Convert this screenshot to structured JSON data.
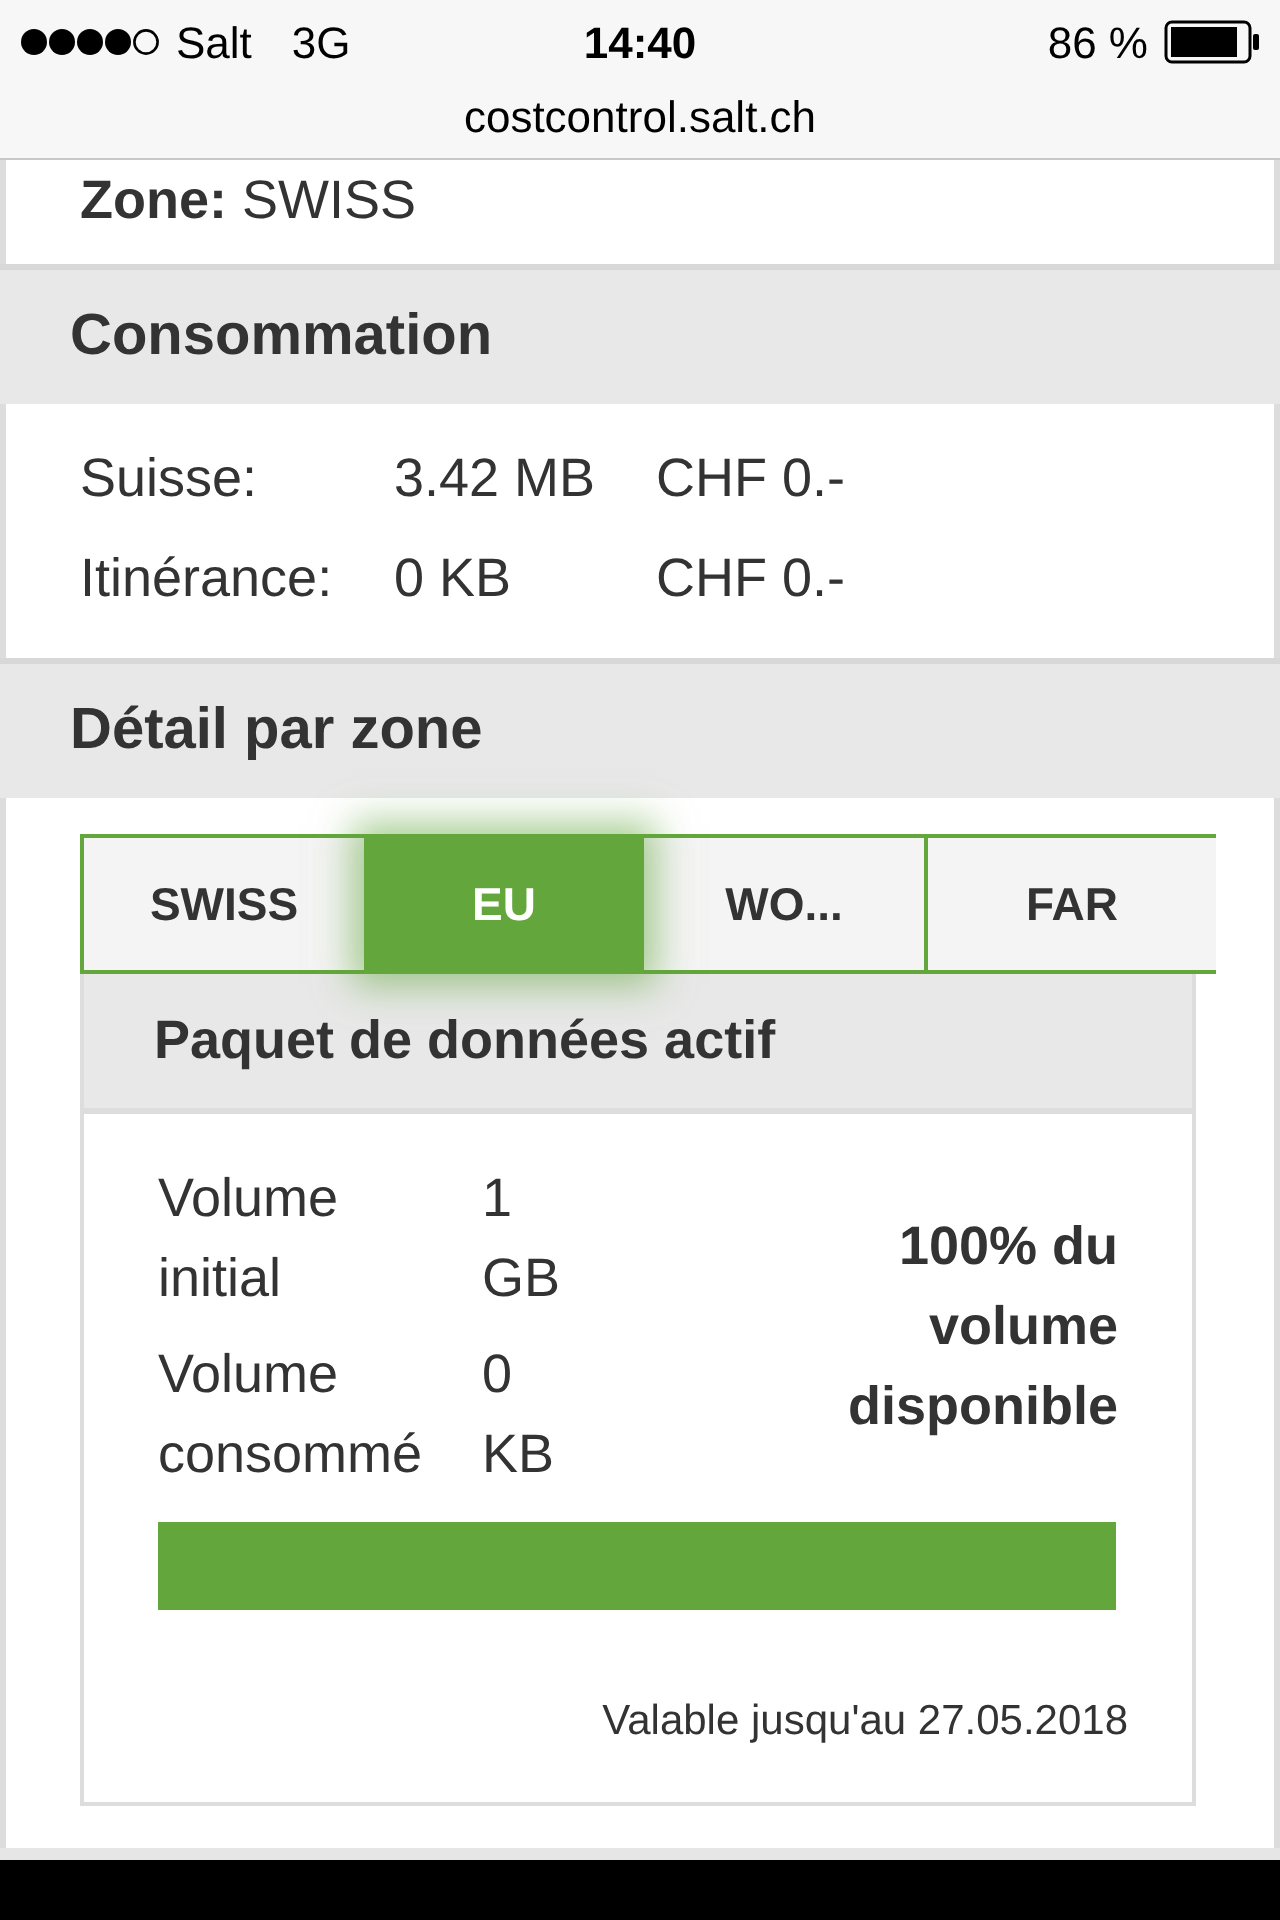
{
  "status_bar": {
    "carrier": "Salt",
    "network": "3G",
    "time": "14:40",
    "battery": "86 %"
  },
  "address_bar": {
    "url": "costcontrol.salt.ch"
  },
  "zone": {
    "label": "Zone:",
    "value": "SWISS"
  },
  "consumption": {
    "title": "Consommation",
    "rows": [
      {
        "label": "Suisse:",
        "amount": "3.42 MB",
        "cost": "CHF 0.-"
      },
      {
        "label": "Itinérance:",
        "amount": "0 KB",
        "cost": "CHF 0.-"
      }
    ]
  },
  "zone_detail": {
    "title": "Détail par zone",
    "tabs": [
      {
        "label": "SWISS",
        "selected": false
      },
      {
        "label": "EU",
        "selected": true
      },
      {
        "label": "WO...",
        "selected": false
      },
      {
        "label": "FAR",
        "selected": false
      }
    ],
    "package": {
      "title": "Paquet de données actif",
      "rows": [
        {
          "label": "Volume initial",
          "value": "1 GB"
        },
        {
          "label": "Volume consommé",
          "value": "0 KB"
        }
      ],
      "summary": "100% du volume disponible",
      "level": 1,
      "validity": "Valable jusqu'au 27.05.2018"
    }
  }
}
